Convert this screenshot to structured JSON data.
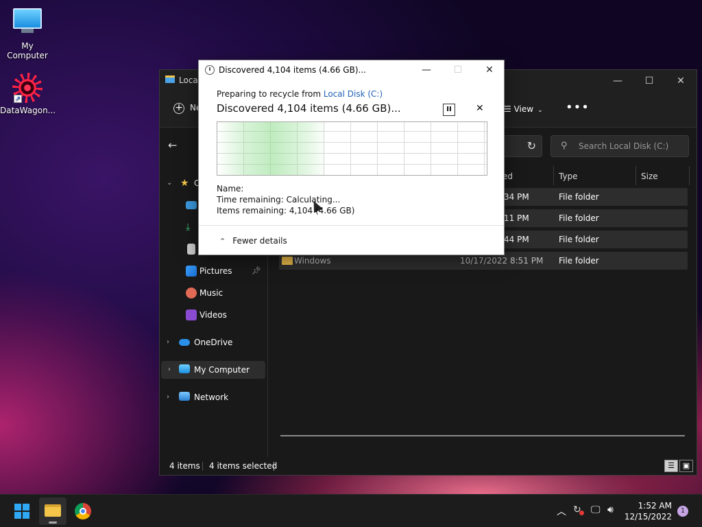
{
  "desktop": {
    "icons": [
      {
        "label": "My Computer",
        "icon": "monitor-icon"
      },
      {
        "label": "DataWagon...",
        "icon": "mandala-shortcut-icon"
      }
    ]
  },
  "explorer": {
    "title": "Local",
    "controls": {
      "minimize": "—",
      "maximize": "☐",
      "close": "✕"
    },
    "toolbar": {
      "new_label": "Ne",
      "view_label": "View",
      "more_label": "•••"
    },
    "search": {
      "placeholder": "Search Local Disk (C:)"
    },
    "nav": {
      "quick_access_label": "C",
      "items": [
        {
          "label": "Pictures"
        },
        {
          "label": "Music"
        },
        {
          "label": "Videos"
        },
        {
          "label": "OneDrive"
        },
        {
          "label": "My Computer"
        },
        {
          "label": "Network"
        }
      ]
    },
    "columns": {
      "modified": "ed",
      "type": "Type",
      "size": "Size"
    },
    "rows": [
      {
        "name": "",
        "modified": "34 PM",
        "type": "File folder"
      },
      {
        "name": "",
        "modified": "11 PM",
        "type": "File folder"
      },
      {
        "name": "",
        "modified": "44 PM",
        "type": "File folder"
      },
      {
        "name": "Windows",
        "modified": "10/17/2022 8:51 PM",
        "type": "File folder"
      }
    ],
    "status": {
      "count": "4 items",
      "selected": "4 items selected"
    }
  },
  "dialog": {
    "title": "Discovered 4,104 items (4.66 GB)...",
    "preparing_prefix": "Preparing to recycle from ",
    "preparing_link": "Local Disk (C:)",
    "big_status": "Discovered 4,104 items (4.66 GB)...",
    "name_label": "Name:",
    "time_remaining": "Time remaining:  Calculating...",
    "items_remaining": "Items remaining:  4,104 (4.66 GB)",
    "fewer_details": "Fewer details",
    "pause_label": "II",
    "close_label": "✕"
  },
  "taskbar": {
    "time": "1:52 AM",
    "date": "12/15/2022",
    "notification_count": "1"
  }
}
